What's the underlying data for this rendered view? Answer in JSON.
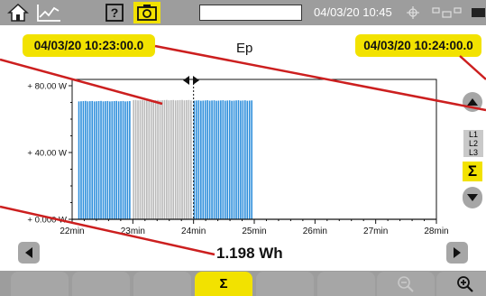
{
  "top": {
    "datetime": "04/03/20 10:45",
    "icons": [
      "home-icon",
      "trend-icon",
      "help-icon",
      "camera-icon",
      "gps-icon",
      "network-icon",
      "battery-icon"
    ]
  },
  "cursors": {
    "left_timestamp": "04/03/20 10:23:00.0",
    "right_timestamp": "04/03/20 10:24:00.0"
  },
  "measure": {
    "label": "Ep",
    "value": "1.198 Wh"
  },
  "side": {
    "levels": [
      "L1",
      "L2",
      "L3"
    ],
    "sigma": "Σ"
  },
  "tabs": {
    "sigma": "Σ"
  },
  "colors": {
    "bar_blue": "#2e8fdc",
    "bar_grey_selected": "#b9b9b9",
    "accent_yellow": "#f2e200",
    "bar_background": "#9d9d9d",
    "callout_red": "#cc1f1f"
  },
  "chart_data": {
    "type": "bar",
    "title": "Ep",
    "x_ticks": [
      "22min",
      "23min",
      "24min",
      "25min",
      "26min",
      "27min",
      "28min"
    ],
    "y_ticks": [
      "+ 0.000 W",
      "+ 40.00 W",
      "+ 80.00 W"
    ],
    "ylim": [
      0,
      80
    ],
    "xlim_min": [
      22,
      28
    ],
    "series": [
      {
        "x_start_min": 22.1,
        "x_end_min": 23.0,
        "value": 70.6
      },
      {
        "x_start_min": 23.0,
        "x_end_min": 24.0,
        "value": 71.2,
        "selected": true
      },
      {
        "x_start_min": 24.0,
        "x_end_min": 25.0,
        "value": 71.0
      }
    ],
    "grid": false
  }
}
